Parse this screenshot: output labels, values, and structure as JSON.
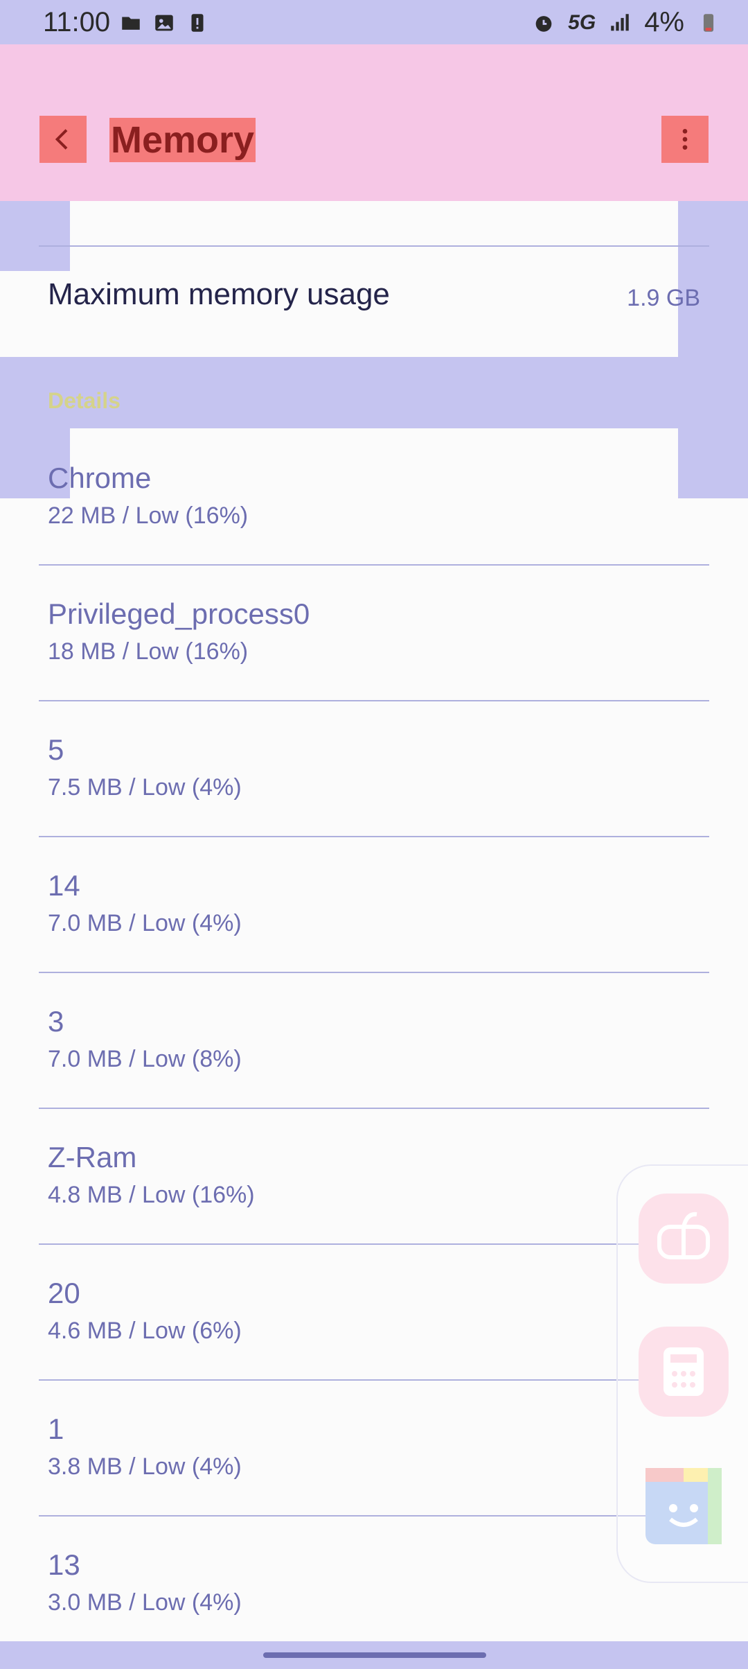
{
  "status_bar": {
    "time": "11:00",
    "network": "5G",
    "battery": "4%"
  },
  "header": {
    "title": "Memory"
  },
  "summary": {
    "max_memory_label": "Maximum memory usage",
    "max_memory_value": "1.9 GB"
  },
  "details": {
    "section_label": "Details",
    "rows": [
      {
        "title": "Chrome",
        "sub": "22 MB / Low (16%)"
      },
      {
        "title": "Privileged_process0",
        "sub": "18 MB / Low (16%)"
      },
      {
        "title": "5",
        "sub": "7.5 MB / Low (4%)"
      },
      {
        "title": "14",
        "sub": "7.0 MB / Low (4%)"
      },
      {
        "title": "3",
        "sub": "7.0 MB / Low (8%)"
      },
      {
        "title": "Z-Ram",
        "sub": "4.8 MB / Low (16%)"
      },
      {
        "title": "20",
        "sub": "4.6 MB / Low (6%)"
      },
      {
        "title": "1",
        "sub": "3.8 MB / Low (4%)"
      },
      {
        "title": "13",
        "sub": "3.0 MB / Low (4%)"
      }
    ]
  },
  "icons": {
    "status_left": [
      "folder-icon",
      "image-icon",
      "alert-icon"
    ],
    "status_right": [
      "alarm-icon",
      "signal-icon",
      "battery-icon"
    ],
    "header": [
      "back-icon",
      "more-vertical-icon"
    ],
    "side_panel": [
      "game-launcher-icon",
      "calculator-icon",
      "bixby-icon"
    ]
  },
  "colors": {
    "accent": "#6c6db0",
    "title_red": "#8a1f1f",
    "header_pink": "#f6c7e6"
  }
}
